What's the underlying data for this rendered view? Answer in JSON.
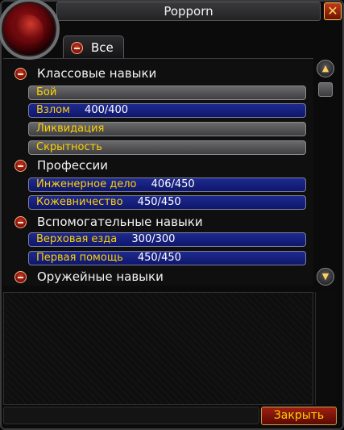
{
  "window": {
    "title": "Popporn",
    "close_glyph": "✕"
  },
  "tab": {
    "label": "Все"
  },
  "categories": [
    {
      "label": "Классовые навыки",
      "skills": [
        {
          "name": "Бой",
          "value": "",
          "style": "grey"
        },
        {
          "name": "Взлом",
          "value": "400/400",
          "style": "blue"
        },
        {
          "name": "Ликвидация",
          "value": "",
          "style": "grey"
        },
        {
          "name": "Скрытность",
          "value": "",
          "style": "grey"
        }
      ]
    },
    {
      "label": "Профессии",
      "skills": [
        {
          "name": "Инженерное дело",
          "value": "406/450",
          "style": "blue"
        },
        {
          "name": "Кожевничество",
          "value": "450/450",
          "style": "blue"
        }
      ]
    },
    {
      "label": "Вспомогательные навыки",
      "skills": [
        {
          "name": "Верховая езда",
          "value": "300/300",
          "style": "blue"
        },
        {
          "name": "Первая помощь",
          "value": "450/450",
          "style": "blue"
        }
      ]
    },
    {
      "label": "Оружейные навыки",
      "skills": []
    }
  ],
  "footer": {
    "close_label": "Закрыть"
  },
  "colors": {
    "skill_name": "#ffd100",
    "skill_value": "#ffffff",
    "bar_blue": "#1f2a8f",
    "bar_grey": "#5a5a5c"
  }
}
